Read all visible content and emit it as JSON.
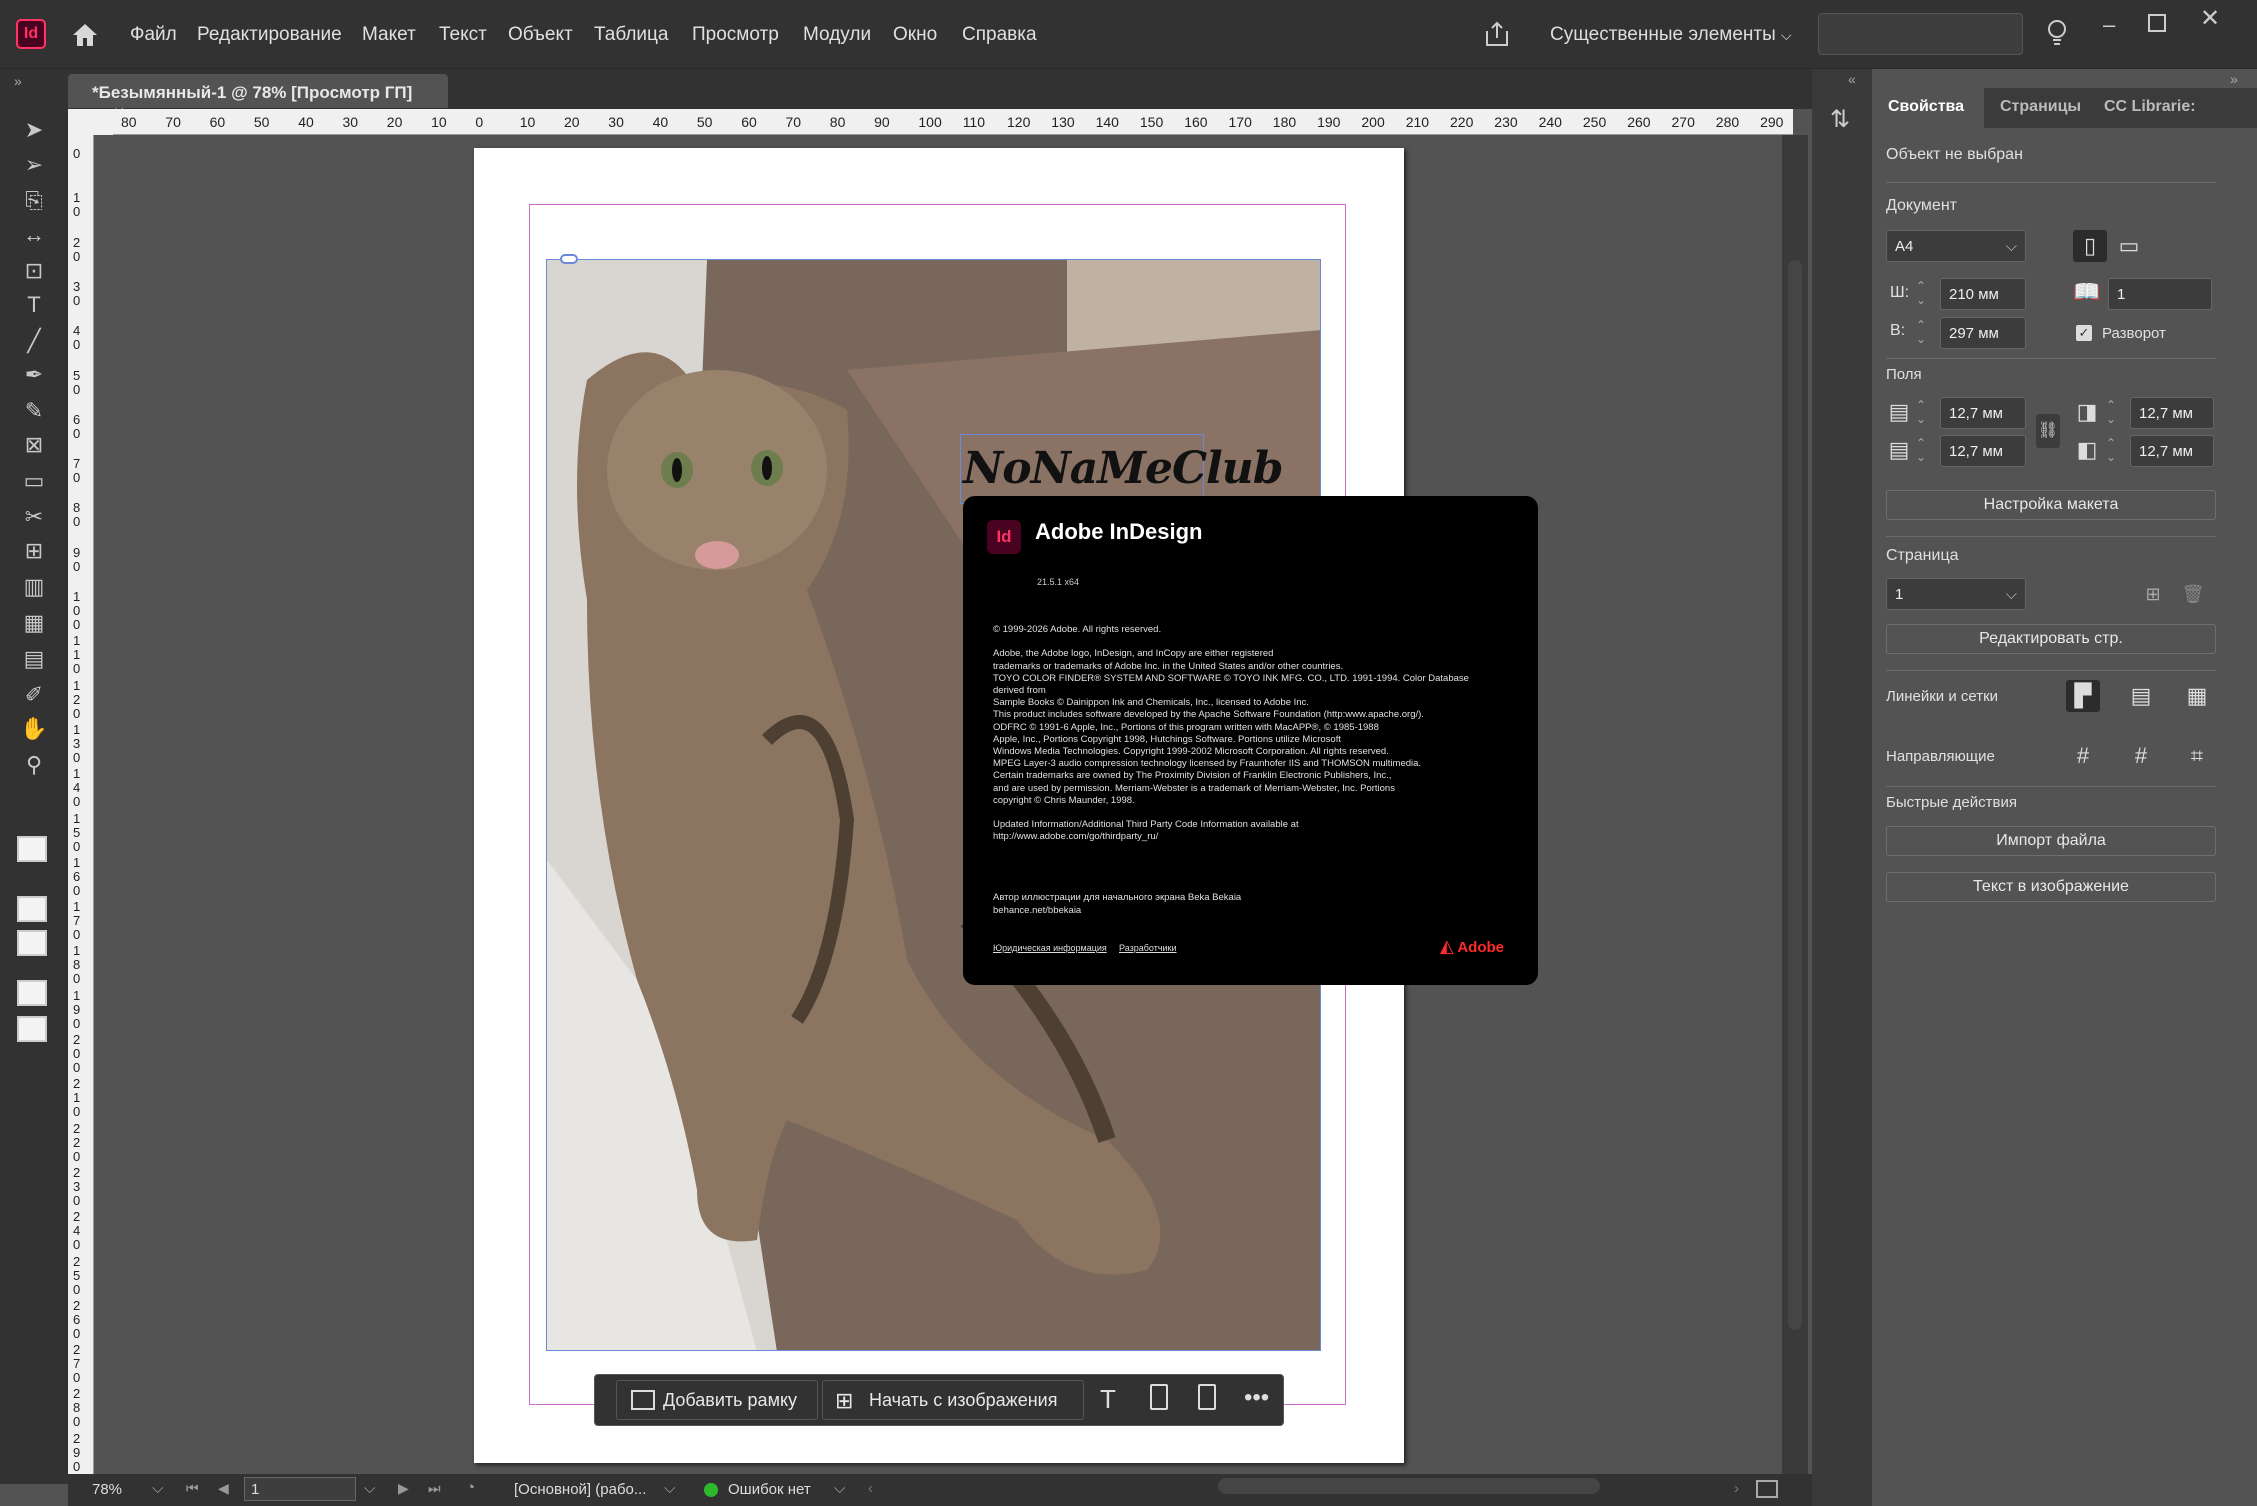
{
  "app": {
    "logo_text": "Id",
    "workspace": "Существенные элементы"
  },
  "menu": [
    "Файл",
    "Редактирование",
    "Макет",
    "Текст",
    "Объект",
    "Таблица",
    "Просмотр",
    "Модули",
    "Окно",
    "Справка"
  ],
  "document_tab": {
    "title": "*Безымянный-1 @ 78% [Просмотр ГП]",
    "close": "×"
  },
  "ruler_h": [
    "80",
    "70",
    "60",
    "50",
    "40",
    "30",
    "20",
    "10",
    "0",
    "10",
    "20",
    "30",
    "40",
    "50",
    "60",
    "70",
    "80",
    "90",
    "100",
    "110",
    "120",
    "130",
    "140",
    "150",
    "160",
    "170",
    "180",
    "190",
    "200",
    "210",
    "220",
    "230",
    "240",
    "250",
    "260",
    "270",
    "280",
    "290"
  ],
  "ruler_v": [
    "0",
    "10",
    "20",
    "30",
    "40",
    "50",
    "60",
    "70",
    "80",
    "90",
    "100",
    "110",
    "120",
    "130",
    "140",
    "150",
    "160",
    "170",
    "180",
    "190",
    "200",
    "210",
    "220",
    "230",
    "240",
    "250",
    "260",
    "270",
    "280",
    "290"
  ],
  "canvas": {
    "text_frame": "NoNaMeClub"
  },
  "about": {
    "logo": "Id",
    "title": "Adobe InDesign",
    "version": "21.5.1 x64",
    "copyright": "© 1999-2026 Adobe. All rights reserved.\n\nAdobe, the Adobe logo, InDesign, and InCopy are either registered\ntrademarks or trademarks of Adobe Inc. in the United States and/or other countries.\nTOYO COLOR FINDER® SYSTEM AND SOFTWARE © TOYO INK MFG. CO., LTD. 1991-1994. Color Database\nderived from\nSample Books © Dainippon Ink and Chemicals, Inc., licensed to Adobe Inc.\nThis product includes software developed by the Apache Software Foundation (http:www.apache.org/).\nODFRC © 1991-6 Apple, Inc., Portions of this program written with MacAPP®, © 1985-1988\nApple, Inc., Portions Copyright 1998, Hutchings Software. Portions utilize Microsoft\nWindows Media Technologies. Copyright 1999-2002 Microsoft Corporation. All rights reserved.\nMPEG Layer-3 audio compression technology licensed by Fraunhofer IIS and THOMSON multimedia.\nCertain trademarks are owned by The Proximity Division of Franklin Electronic Publishers, Inc.,\nand are used by permission. Merriam-Webster is a trademark of Merriam-Webster, Inc. Portions\ncopyright © Chris Maunder, 1998.\n\nUpdated Information/Additional Third Party Code Information available at\nhttp://www.adobe.com/go/thirdparty_ru/\n\n\n\n\nАвтор иллюстрации для начального экрана Beka Bekaia\nbehance.net/bbekaia",
    "link_legal": "Юридическая информация",
    "link_dev": "Разработчики",
    "adobe": "Adobe"
  },
  "context_bar": {
    "add_frame": "Добавить рамку",
    "start_image": "Начать с изображения"
  },
  "status": {
    "zoom": "78%",
    "page": "1",
    "style": "[Основной] (рабо...",
    "errors": "Ошибок нет"
  },
  "panel": {
    "tabs": [
      "Свойства",
      "Страницы",
      "CC Librarie:"
    ],
    "no_selection": "Объект не выбран",
    "document_label": "Документ",
    "page_size": "A4",
    "width_label": "Ш:",
    "width": "210 мм",
    "height_label": "В:",
    "height": "297 мм",
    "pages_count": "1",
    "spread_label": "Разворот",
    "margins_label": "Поля",
    "margin_top": "12,7 мм",
    "margin_bottom": "12,7 мм",
    "margin_left": "12,7 мм",
    "margin_right": "12,7 мм",
    "layout_button": "Настройка макета",
    "page_label": "Страница",
    "page_value": "1",
    "edit_page_button": "Редактировать стр.",
    "rulers_label": "Линейки и сетки",
    "guides_label": "Направляющие",
    "quick_actions_label": "Быстрые действия",
    "import_button": "Импорт файла",
    "text_image_button": "Текст в изображение"
  }
}
